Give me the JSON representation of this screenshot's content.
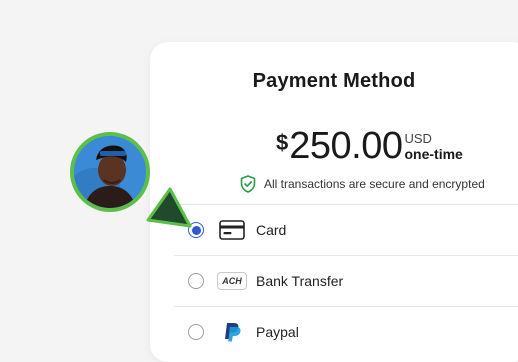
{
  "panel": {
    "title": "Payment Method"
  },
  "price": {
    "symbol": "$",
    "amount": "250.00",
    "currency": "USD",
    "frequency": "one-time"
  },
  "security": {
    "icon": "shield-check-icon",
    "text": "All transactions are secure and encrypted",
    "color": "#2e9a46"
  },
  "methods": [
    {
      "label": "Card",
      "icon": "credit-card-icon",
      "selected": true
    },
    {
      "label": "Bank Transfer",
      "icon": "ach-icon",
      "badge": "ACH",
      "selected": false
    },
    {
      "label": "Paypal",
      "icon": "paypal-icon",
      "selected": false
    }
  ],
  "colors": {
    "accent": "#2f5bd1",
    "avatar_ring": "#5cbf4a",
    "cursor_fill": "#1f4a2c"
  }
}
